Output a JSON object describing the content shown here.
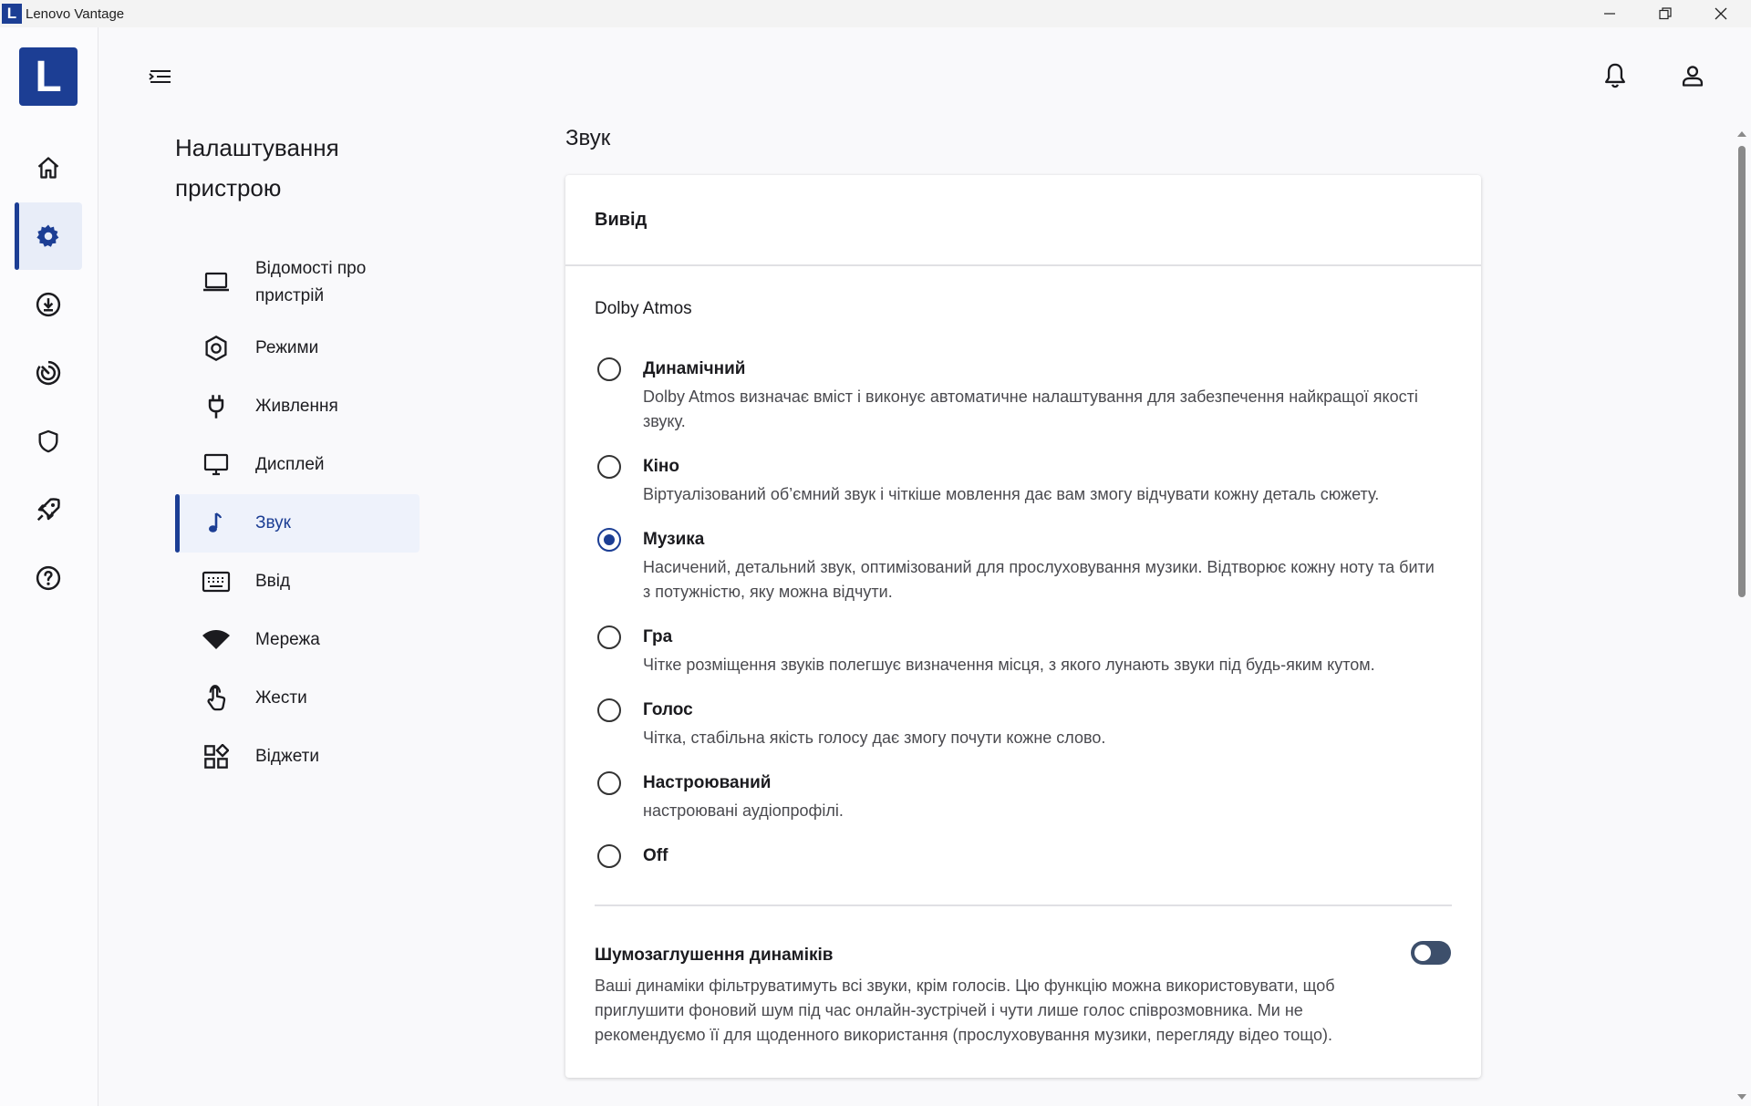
{
  "window": {
    "badge": "L",
    "title": "Lenovo Vantage"
  },
  "rail": {
    "logo": "L",
    "items": [
      {
        "icon": "home-icon",
        "active": false
      },
      {
        "icon": "gear-icon",
        "active": true
      },
      {
        "icon": "download-icon",
        "active": false
      },
      {
        "icon": "gauge-icon",
        "active": false
      },
      {
        "icon": "shield-icon",
        "active": false
      },
      {
        "icon": "rocket-icon",
        "active": false
      },
      {
        "icon": "help-icon",
        "active": false
      }
    ]
  },
  "header": {
    "icons": [
      "menu-collapse-icon",
      "bell-icon",
      "user-icon"
    ]
  },
  "sidebar": {
    "title": "Налаштування пристрою",
    "items": [
      {
        "label": "Відомості про пристрій",
        "icon": "laptop-icon"
      },
      {
        "label": "Режими",
        "icon": "hexagon-icon"
      },
      {
        "label": "Живлення",
        "icon": "plug-icon"
      },
      {
        "label": "Дисплей",
        "icon": "monitor-icon"
      },
      {
        "label": "Звук",
        "icon": "music-note-icon",
        "active": true
      },
      {
        "label": "Ввід",
        "icon": "keyboard-icon"
      },
      {
        "label": "Мережа",
        "icon": "wifi-icon"
      },
      {
        "label": "Жести",
        "icon": "touch-icon"
      },
      {
        "label": "Віджети",
        "icon": "widgets-icon"
      }
    ]
  },
  "main": {
    "title": "Звук",
    "card_title": "Вивід",
    "dolby_label": "Dolby Atmos",
    "options": [
      {
        "title": "Динамічний",
        "desc": "Dolby Atmos визначає вміст і виконує автоматичне налаштування для забезпечення найкращої якості звуку.",
        "checked": false
      },
      {
        "title": "Кіно",
        "desc": "Віртуалізований об’ємний звук і чіткіше мовлення дає вам змогу відчувати кожну деталь сюжету.",
        "checked": false
      },
      {
        "title": "Музика",
        "desc": "Насичений, детальний звук, оптимізований для прослуховування музики. Відтворює кожну ноту та бити з потужністю, яку можна відчути.",
        "checked": true
      },
      {
        "title": "Гра",
        "desc": "Чітке розміщення звуків полегшує визначення місця, з якого лунають звуки під будь-яким кутом.",
        "checked": false
      },
      {
        "title": "Голос",
        "desc": "Чітка, стабільна якість голосу дає змогу почути кожне слово.",
        "checked": false
      },
      {
        "title": "Настроюваний",
        "desc": "настроювані аудіопрофілі.",
        "checked": false
      },
      {
        "title": "Off",
        "desc": "",
        "checked": false
      }
    ],
    "noise_cancel": {
      "title": "Шумозаглушення динаміків",
      "desc": "Ваші динаміки фільтруватимуть всі звуки, крім голосів. Цю функцію можна використовувати, щоб приглушити фоновий шум під час онлайн-зустрічей і чути лише голос співрозмовника. Ми не рекомендуємо її для щоденного використання (прослуховування музики, перегляду відео тощо).",
      "enabled": false
    }
  },
  "colors": {
    "accent": "#1c3e94",
    "active_bg": "#eef2fb"
  }
}
